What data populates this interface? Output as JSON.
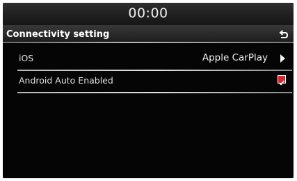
{
  "status_bar": {
    "time": "00:00"
  },
  "header": {
    "title": "Connectivity setting",
    "back_icon": "return-arrow-icon"
  },
  "settings": [
    {
      "label": "iOS",
      "value": "Apple CarPlay",
      "icon": "chevron-right-icon"
    },
    {
      "label": "Android Auto Enabled",
      "checked": true,
      "icon": "checkbox-checked-icon"
    }
  ],
  "colors": {
    "background": "#050505",
    "text": "#e0e0e0",
    "checkbox": "#d9262b"
  }
}
